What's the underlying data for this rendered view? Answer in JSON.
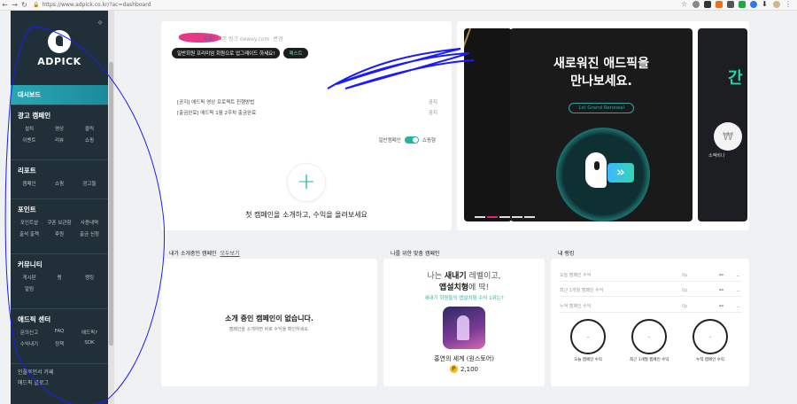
{
  "browser": {
    "url": "https://www.adpick.co.kr/?ac=dashboard"
  },
  "sidebar": {
    "logo": "ADPICK",
    "active": "대시보드",
    "sections": [
      {
        "title": "광고 캠페인",
        "items": [
          "설치",
          "영상",
          "클릭",
          "이벤트",
          "리뷰",
          "쇼핑"
        ]
      },
      {
        "title": "리포트",
        "items": [
          "캠페인",
          "쇼핑",
          "광고들"
        ]
      },
      {
        "title": "포인트",
        "items": [
          "포인트샵",
          "쿠폰 보관함",
          "사용내역",
          "출석 출첵",
          "후원",
          "출금 신청"
        ]
      },
      {
        "title": "커뮤니티",
        "items": [
          "게시판",
          "랭",
          "랭킹",
          "알림"
        ]
      },
      {
        "title": "애드픽 센터",
        "items": [
          "문의신고",
          "FAQ",
          "애드픽?",
          "수익내기",
          "정책",
          "SDK"
        ]
      }
    ],
    "links": [
      "인플루언서 카페",
      "애드픽 블로그"
    ]
  },
  "profile": {
    "suffix": "회원",
    "label": "기본 링크 oewey.com",
    "badge": "변경",
    "tag_upgrade": "일반회원 프리미엄 회원으로 업그레이드 하세요!",
    "tag_green": "패스트",
    "notices": [
      {
        "text": "[공지] 애드픽 영상 프로젝트 진행방법",
        "tag": "공지"
      },
      {
        "text": "[출금완료] 애드픽 1월 2주차 출금완료",
        "tag": "공지"
      }
    ],
    "toggle_left": "일반캠페인",
    "toggle_right": "쇼핑형",
    "cta": "첫 캠페인을 소개하고, 수익을 올려보세요"
  },
  "banner": {
    "title_line1": "새로워진 애드픽을",
    "title_line2": "만나보세요.",
    "renewal": "1st Grand Renewal",
    "right_text": "간",
    "right_coin": "₩",
    "right_sub": "소액비나"
  },
  "campaign": {
    "header": "내가 소개중인 캠페인",
    "header_link": "모두보기",
    "empty_title": "소개 중인 캠페인이 없습니다.",
    "empty_sub": "캠페인을 소개하면 바로 수익을 확인하세요."
  },
  "match": {
    "header": "나를 위한 맞춤 캠페인",
    "line1_prefix": "나는 ",
    "line1_bold": "새내기",
    "line1_suffix": " 레벨이고,",
    "line2_bold": "앱설치형",
    "line2_suffix": "에 딱!",
    "line3": "새내기 회원들의 앱설치형 수익 1위는?",
    "game": "홍연의 세계 (원스토어)",
    "points": "2,100"
  },
  "rank": {
    "header": "내 랭킹",
    "rows": [
      {
        "label": "오늘 캠페인 수익",
        "p": "0p",
        "v": "--",
        "t": ".."
      },
      {
        "label": "최근 1개월 캠페인 수익",
        "p": "0p",
        "v": "--",
        "t": ".."
      },
      {
        "label": "누적 캠페인 수익",
        "p": "0p",
        "v": "--",
        "t": ".."
      }
    ],
    "circles": [
      {
        "value": "..",
        "label": "오늘 캠페인 수익"
      },
      {
        "value": "..",
        "label": "최근 1개월 캠페인 수익"
      },
      {
        "value": "..",
        "label": "누적 캠페인 수익"
      }
    ]
  },
  "colors": {
    "sidebar": "#213038",
    "accent": "#2aa7b3",
    "pink": "#e2237a",
    "annotation": "#1a1aff"
  }
}
